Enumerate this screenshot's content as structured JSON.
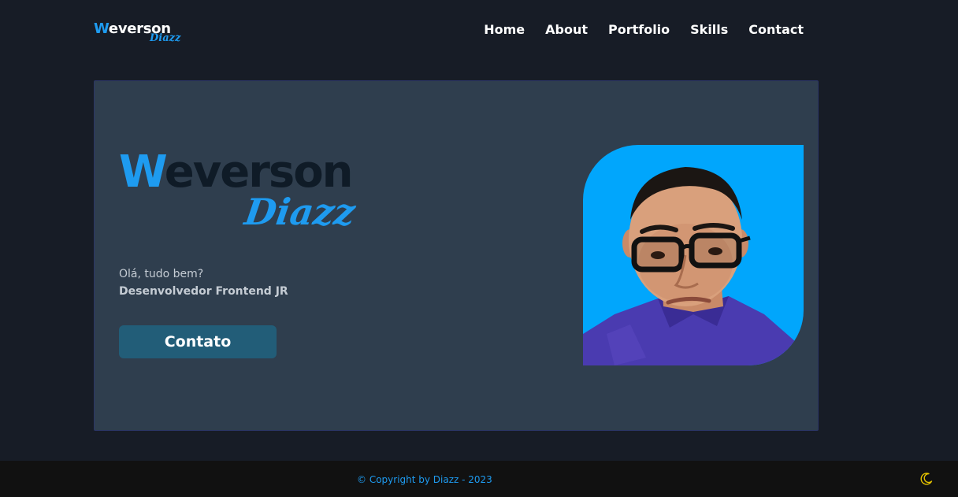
{
  "header": {
    "logo": {
      "initial": "W",
      "rest": "everson",
      "script": "Diazz"
    },
    "nav": [
      {
        "label": "Home"
      },
      {
        "label": "About"
      },
      {
        "label": "Portfolio"
      },
      {
        "label": "Skills"
      },
      {
        "label": "Contact"
      }
    ]
  },
  "hero": {
    "logo": {
      "initial": "W",
      "rest": "everson",
      "script": "Diazz"
    },
    "greeting": "Olá, tudo bem?",
    "role": "Desenvolvedor Frontend JR",
    "cta_label": "Contato",
    "photo_icon": "profile-photo"
  },
  "footer": {
    "copyright": "© Copyright by Diazz - 2023",
    "theme_icon": "moon-icon"
  },
  "colors": {
    "background": "#171c26",
    "card": "#2f3e4e",
    "accent": "#1e9bf0",
    "button": "#225d78",
    "photo_bg": "#01a6fc",
    "footer": "#111111",
    "moon": "#e5c300"
  }
}
